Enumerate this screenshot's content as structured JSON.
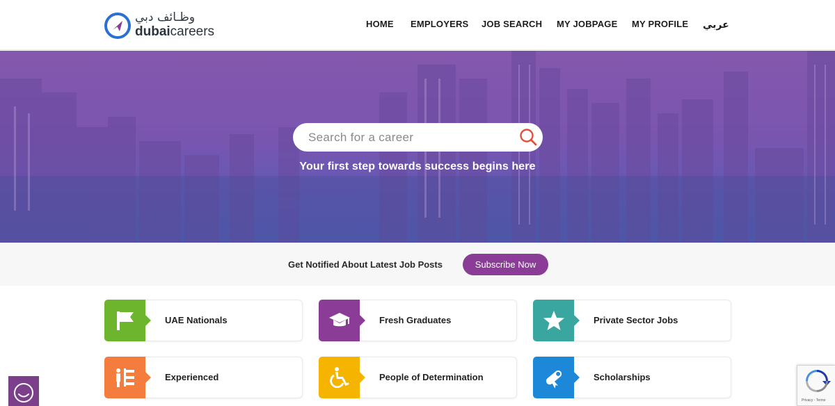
{
  "brand": {
    "arabic_name": "وظـائف دبي",
    "name_bold": "dubai",
    "name_light": "careers"
  },
  "nav": {
    "items": [
      {
        "label": "HOME"
      },
      {
        "label": "EMPLOYERS"
      },
      {
        "label": "JOB SEARCH"
      },
      {
        "label": "MY JOBPAGE"
      },
      {
        "label": "MY PROFILE"
      },
      {
        "label": "عربي"
      }
    ]
  },
  "hero": {
    "search_placeholder": "Search for a career",
    "tagline": "Your first step towards success begins here"
  },
  "notify": {
    "text": "Get Notified About Latest Job Posts",
    "button": "Subscribe Now"
  },
  "categories": [
    {
      "label": "UAE Nationals",
      "icon": "flag-icon",
      "color": "#6cb52d"
    },
    {
      "label": "Fresh Graduates",
      "icon": "graduation-cap-icon",
      "color": "#8a3c96"
    },
    {
      "label": "Private Sector Jobs",
      "icon": "star-icon",
      "color": "#3aa6a0"
    },
    {
      "label": "Experienced",
      "icon": "org-chart-icon",
      "color": "#f47c3c"
    },
    {
      "label": "People of Determination",
      "icon": "wheelchair-icon",
      "color": "#f5b400"
    },
    {
      "label": "Scholarships",
      "icon": "diploma-icon",
      "color": "#1e88d8"
    }
  ],
  "colors": {
    "brand_purple": "#8a3c96",
    "brand_blue": "#2a6fd1",
    "search_icon": "#e0533a"
  },
  "recaptcha": {
    "footer": "Privacy - Terms"
  }
}
